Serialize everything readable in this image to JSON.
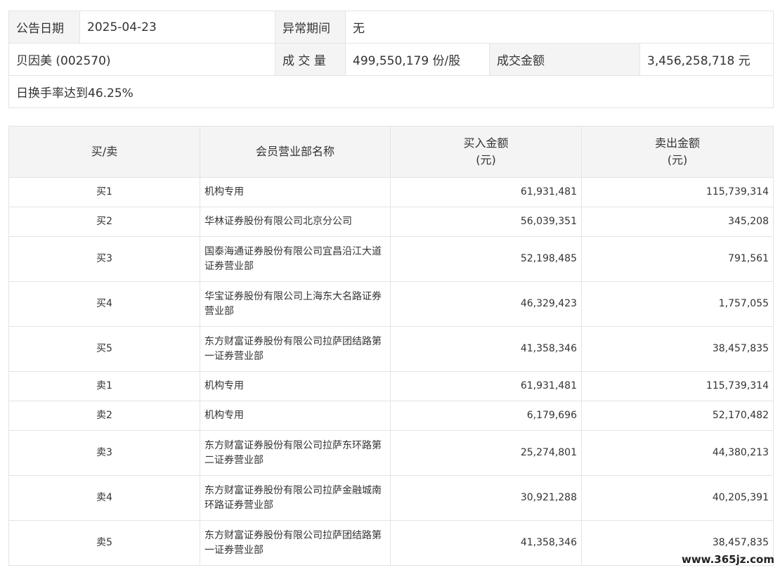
{
  "info": {
    "date_label": "公告日期",
    "date_value": "2025-04-23",
    "abnormal_label": "异常期间",
    "abnormal_value": "无",
    "stock_name": "贝因美 (002570)",
    "volume_label": "成 交 量",
    "volume_value": "499,550,179 份/股",
    "amount_label": "成交金额",
    "amount_value": "3,456,258,718 元",
    "reason": "日换手率达到46.25%"
  },
  "table": {
    "headers": {
      "side": "买/卖",
      "member": "会员营业部名称",
      "buy_line1": "买入金额",
      "buy_line2": "(元)",
      "sell_line1": "卖出金额",
      "sell_line2": "(元)"
    },
    "rows": [
      {
        "side": "买1",
        "member": "机构专用",
        "buy": "61,931,481",
        "sell": "115,739,314"
      },
      {
        "side": "买2",
        "member": "华林证券股份有限公司北京分公司",
        "buy": "56,039,351",
        "sell": "345,208"
      },
      {
        "side": "买3",
        "member": "国泰海通证券股份有限公司宜昌沿江大道证券营业部",
        "buy": "52,198,485",
        "sell": "791,561"
      },
      {
        "side": "买4",
        "member": "华宝证券股份有限公司上海东大名路证券营业部",
        "buy": "46,329,423",
        "sell": "1,757,055"
      },
      {
        "side": "买5",
        "member": "东方财富证券股份有限公司拉萨团结路第一证券营业部",
        "buy": "41,358,346",
        "sell": "38,457,835"
      },
      {
        "side": "卖1",
        "member": "机构专用",
        "buy": "61,931,481",
        "sell": "115,739,314"
      },
      {
        "side": "卖2",
        "member": "机构专用",
        "buy": "6,179,696",
        "sell": "52,170,482"
      },
      {
        "side": "卖3",
        "member": "东方财富证券股份有限公司拉萨东环路第二证券营业部",
        "buy": "25,274,801",
        "sell": "44,380,213"
      },
      {
        "side": "卖4",
        "member": "东方财富证券股份有限公司拉萨金融城南环路证券营业部",
        "buy": "30,921,288",
        "sell": "40,205,391"
      },
      {
        "side": "卖5",
        "member": "东方财富证券股份有限公司拉萨团结路第一证券营业部",
        "buy": "41,358,346",
        "sell": "38,457,835"
      }
    ]
  },
  "watermark": "www.365jz.com"
}
